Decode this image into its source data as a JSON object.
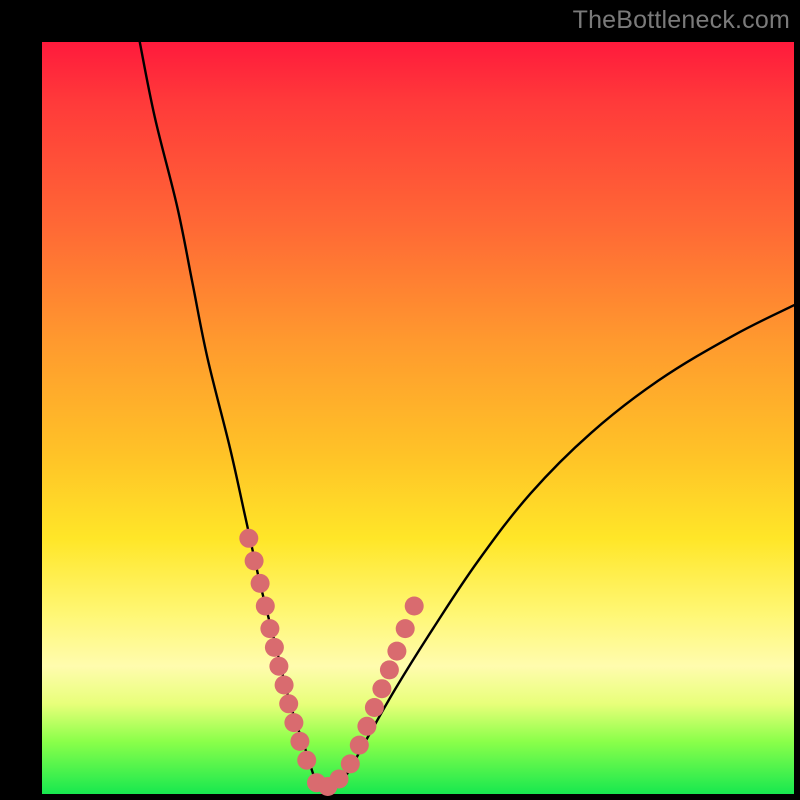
{
  "watermark": "TheBottleneck.com",
  "colors": {
    "curve": "#000000",
    "marker": "#d96b6f",
    "marker_stroke": "#c95a5e"
  },
  "chart_data": {
    "type": "line",
    "title": "",
    "xlabel": "",
    "ylabel": "",
    "xlim": [
      0,
      100
    ],
    "ylim": [
      0,
      100
    ],
    "grid": false,
    "legend": false,
    "note": "V-shaped bottleneck curve; y≈0 near x≈37; values estimated from gridless plot",
    "series": [
      {
        "name": "bottleneck-curve",
        "x": [
          13,
          15,
          18,
          20,
          22,
          25,
          27,
          29,
          31,
          33,
          35,
          37,
          40,
          43,
          47,
          52,
          58,
          65,
          73,
          82,
          92,
          100
        ],
        "y": [
          100,
          90,
          78,
          68,
          58,
          46,
          37,
          28,
          20,
          12,
          6,
          1,
          2,
          7,
          14,
          22,
          31,
          40,
          48,
          55,
          61,
          65
        ]
      }
    ],
    "markers": {
      "name": "highlight-dots",
      "x": [
        27.5,
        28.2,
        29.0,
        29.7,
        30.3,
        30.9,
        31.5,
        32.2,
        32.8,
        33.5,
        34.3,
        35.2,
        36.5,
        38.0,
        39.5,
        41.0,
        42.2,
        43.2,
        44.2,
        45.2,
        46.2,
        47.2,
        48.3,
        49.5
      ],
      "y": [
        34,
        31,
        28,
        25,
        22,
        19.5,
        17,
        14.5,
        12,
        9.5,
        7,
        4.5,
        1.5,
        1,
        2,
        4,
        6.5,
        9,
        11.5,
        14,
        16.5,
        19,
        22,
        25
      ]
    }
  }
}
